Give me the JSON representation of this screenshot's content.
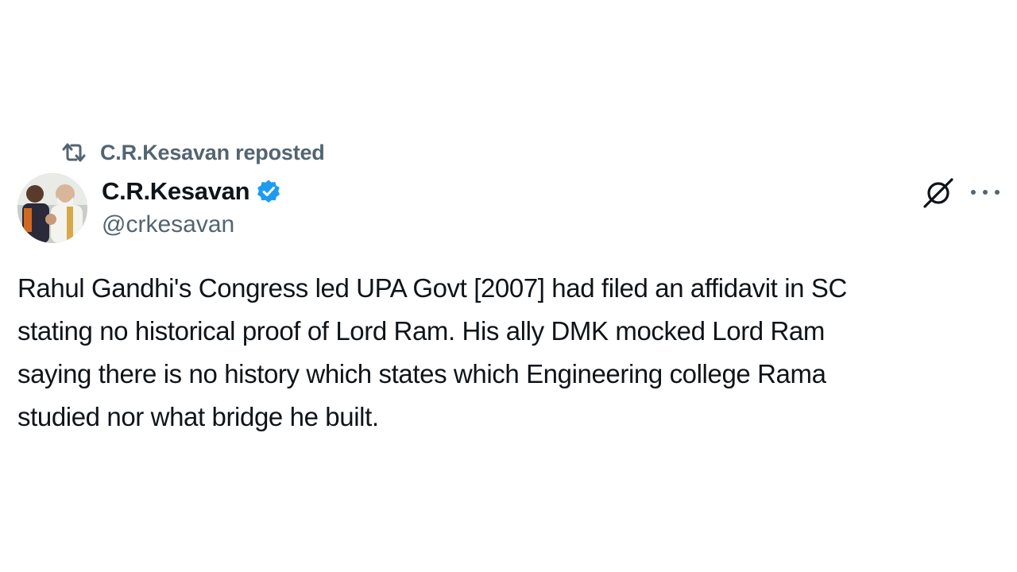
{
  "repost": {
    "text": "C.R.Kesavan reposted",
    "icon": "repost-icon"
  },
  "author": {
    "display_name": "C.R.Kesavan",
    "handle": "@crkesavan",
    "verified_icon": "verified-badge-icon",
    "avatar_icon": "avatar"
  },
  "actions": {
    "grok_icon": "grok-icon",
    "more_icon": "more-options-icon"
  },
  "tweet": {
    "lines": [
      "Rahul Gandhi's Congress led UPA Govt [2007] had filed an affidavit in SC",
      "stating no historical proof of Lord Ram. His ally DMK mocked Lord Ram",
      "saying there is no history which states which Engineering college Rama",
      "studied nor what bridge he built."
    ]
  },
  "colors": {
    "text_primary": "#0f1419",
    "text_secondary": "#536471",
    "verified_blue": "#1d9bf0",
    "background": "#ffffff"
  }
}
